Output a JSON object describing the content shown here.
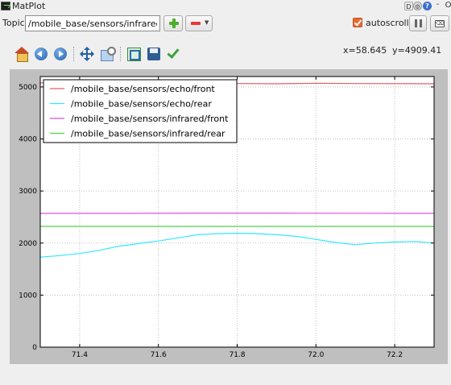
{
  "window": {
    "title": "MatPlot",
    "btn_d": "D",
    "btn_help": "?",
    "btn_min": "-",
    "btn_o": "O"
  },
  "topic": {
    "label": "Topic",
    "value": "/mobile_base/sensors/infrared"
  },
  "autoscroll": {
    "label": "autoscroll",
    "checked": true
  },
  "toolbar": {
    "icons": [
      "home-icon",
      "back-icon",
      "forward-icon",
      "pan-icon",
      "zoom-icon",
      "configure-subplots-icon",
      "save-icon",
      "edit-check-icon"
    ]
  },
  "cursor": {
    "x_text": "x=58.645",
    "y_text": "y=4909.41"
  },
  "chart_data": {
    "type": "line",
    "xlim": [
      71.3,
      72.3
    ],
    "ylim": [
      0,
      5200
    ],
    "x_ticks": [
      71.4,
      71.6,
      71.8,
      72.0,
      72.2
    ],
    "x_tick_labels": [
      "71.4",
      "71.6",
      "71.8",
      "72.0",
      "72.2"
    ],
    "y_ticks": [
      0,
      1000,
      2000,
      3000,
      4000,
      5000
    ],
    "y_tick_labels": [
      "0",
      "1000",
      "2000",
      "3000",
      "4000",
      "5000"
    ],
    "grid": true,
    "legend_position": "top-left",
    "series": [
      {
        "name": "/mobile_base/sensors/echo/front",
        "color": "#e06060",
        "x": [
          71.3,
          71.5,
          71.7,
          71.9,
          72.0,
          72.1,
          72.3
        ],
        "y": [
          5080,
          5080,
          5070,
          5060,
          5070,
          5065,
          5060
        ]
      },
      {
        "name": "/mobile_base/sensors/echo/rear",
        "color": "#33e6ff",
        "x": [
          71.3,
          71.35,
          71.4,
          71.45,
          71.5,
          71.55,
          71.6,
          71.65,
          71.7,
          71.75,
          71.8,
          71.85,
          71.9,
          71.95,
          72.0,
          72.05,
          72.1,
          72.15,
          72.2,
          72.25,
          72.3
        ],
        "y": [
          1730,
          1760,
          1800,
          1860,
          1940,
          1990,
          2040,
          2100,
          2160,
          2180,
          2190,
          2180,
          2160,
          2130,
          2070,
          2010,
          1970,
          2000,
          2020,
          2030,
          2000
        ]
      },
      {
        "name": "/mobile_base/sensors/infrared/front",
        "color": "#e052e0",
        "x": [
          71.3,
          71.5,
          71.7,
          71.9,
          72.1,
          72.3
        ],
        "y": [
          2570,
          2570,
          2575,
          2575,
          2572,
          2570
        ]
      },
      {
        "name": "/mobile_base/sensors/infrared/rear",
        "color": "#4ed24e",
        "x": [
          71.3,
          71.5,
          71.7,
          71.9,
          72.1,
          72.3
        ],
        "y": [
          2320,
          2320,
          2320,
          2320,
          2320,
          2320
        ]
      }
    ]
  }
}
